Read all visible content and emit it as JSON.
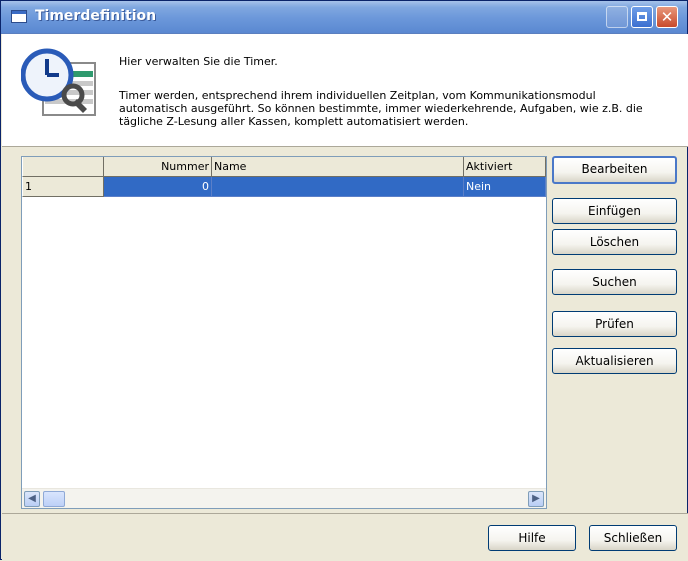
{
  "window": {
    "title": "Timerdefinition"
  },
  "header": {
    "intro": "Hier verwalten Sie die Timer.",
    "description": "Timer werden, entsprechend ihrem individuellen Zeitplan, vom Kommunikationsmodul automatisch ausgeführt. So können bestimmte, immer wiederkehrende, Aufgaben, wie z.B. die tägliche Z-Lesung aller Kassen, komplett automatisiert werden.",
    "icon": "clock-wrench-icon"
  },
  "table": {
    "columns": [
      "Nummer",
      "Name",
      "Aktiviert"
    ],
    "rows": [
      {
        "row_header": "1",
        "nummer": "0",
        "name": "",
        "aktiviert": "Nein",
        "selected": true
      }
    ]
  },
  "side_buttons": {
    "bearbeiten": "Bearbeiten",
    "einfuegen": "Einfügen",
    "loeschen": "Löschen",
    "suchen": "Suchen",
    "pruefen": "Prüfen",
    "aktualisieren": "Aktualisieren"
  },
  "footer": {
    "hilfe": "Hilfe",
    "schliessen": "Schließen"
  },
  "colors": {
    "titlebar": "#7fa7e0",
    "selection": "#316ac5",
    "close_button": "#c84a2c"
  }
}
